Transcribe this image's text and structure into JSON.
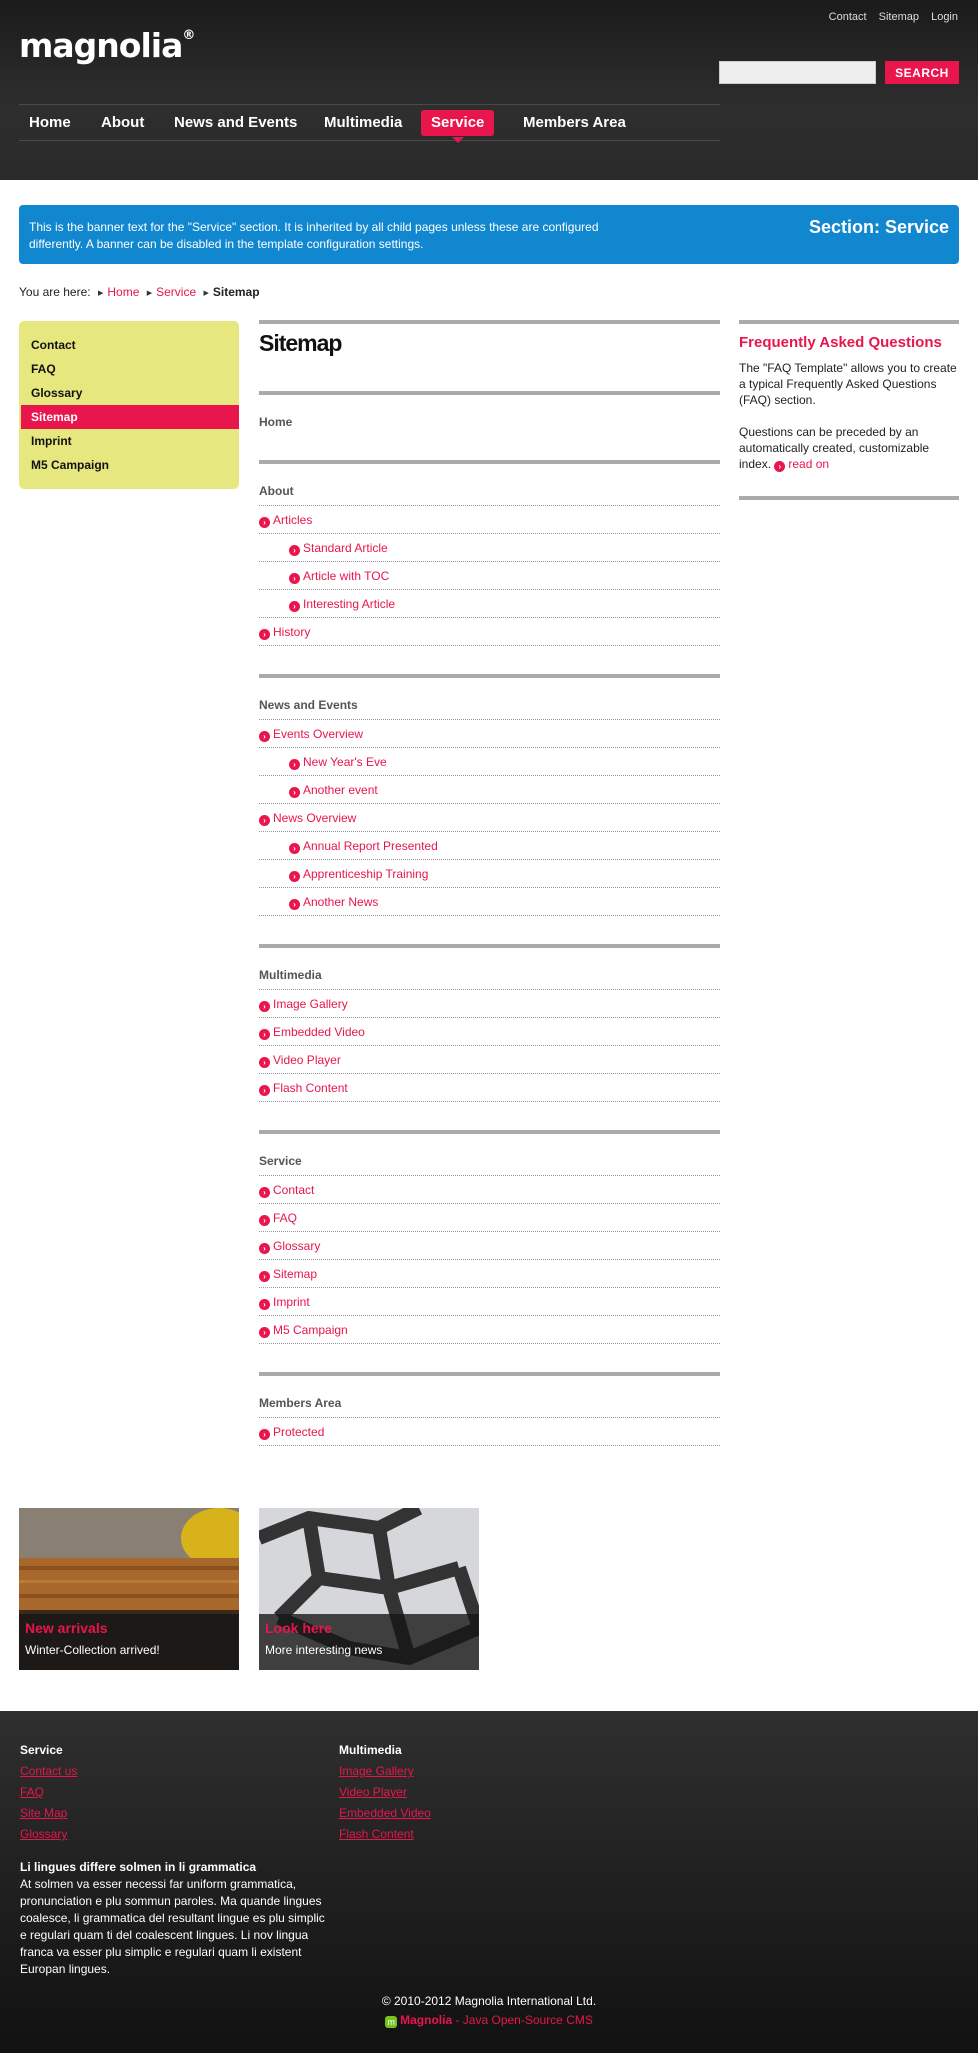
{
  "header": {
    "logo_text": "magnolia",
    "logo_mark": "®",
    "meta_links": [
      "Contact",
      "Sitemap",
      "Login"
    ],
    "search_placeholder": "",
    "search_button": "SEARCH"
  },
  "nav": {
    "items": [
      "Home",
      "About",
      "News and Events",
      "Multimedia",
      "Service",
      "Members Area"
    ],
    "active": "Service"
  },
  "banner": {
    "text": "This is the banner text for the \"Service\" section. It is inherited by all child pages unless these are configured differently. A banner can be disabled in the template configuration settings.",
    "title": "Section: Service"
  },
  "breadcrumb": {
    "prefix": "You are here:",
    "items": [
      "Home",
      "Service"
    ],
    "current": "Sitemap"
  },
  "subnav": {
    "items": [
      "Contact",
      "FAQ",
      "Glossary",
      "Sitemap",
      "Imprint",
      "M5 Campaign"
    ],
    "active": "Sitemap"
  },
  "main": {
    "title": "Sitemap",
    "sections": [
      {
        "heading": "Home",
        "items": []
      },
      {
        "heading": "About",
        "items": [
          {
            "label": "Articles",
            "level": 1
          },
          {
            "label": "Standard Article",
            "level": 2
          },
          {
            "label": "Article with TOC",
            "level": 2
          },
          {
            "label": "Interesting Article",
            "level": 2
          },
          {
            "label": "History",
            "level": 1
          }
        ]
      },
      {
        "heading": "News and Events",
        "items": [
          {
            "label": "Events Overview",
            "level": 1
          },
          {
            "label": "New Year's Eve",
            "level": 2
          },
          {
            "label": "Another event",
            "level": 2
          },
          {
            "label": "News Overview",
            "level": 1
          },
          {
            "label": "Annual Report Presented",
            "level": 2
          },
          {
            "label": "Apprenticeship Training",
            "level": 2
          },
          {
            "label": "Another News",
            "level": 2
          }
        ]
      },
      {
        "heading": "Multimedia",
        "items": [
          {
            "label": "Image Gallery",
            "level": 1
          },
          {
            "label": "Embedded Video",
            "level": 1
          },
          {
            "label": "Video Player",
            "level": 1
          },
          {
            "label": "Flash Content",
            "level": 1
          }
        ]
      },
      {
        "heading": "Service",
        "items": [
          {
            "label": "Contact",
            "level": 1
          },
          {
            "label": "FAQ",
            "level": 1
          },
          {
            "label": "Glossary",
            "level": 1
          },
          {
            "label": "Sitemap",
            "level": 1
          },
          {
            "label": "Imprint",
            "level": 1
          },
          {
            "label": "M5 Campaign",
            "level": 1
          }
        ]
      },
      {
        "heading": "Members Area",
        "items": [
          {
            "label": "Protected",
            "level": 1
          }
        ]
      }
    ]
  },
  "faq": {
    "title": "Frequently Asked Questions",
    "p1": "The \"FAQ Template\" allows you to create a typical Frequently Asked Questions (FAQ) section.",
    "p2": "Questions can be preceded by an automatically created, customizable index.",
    "read_on": "read on"
  },
  "promos": [
    {
      "title": "New arrivals",
      "text": "Winter-Collection arrived!"
    },
    {
      "title": "Look here",
      "text": "More interesting news"
    }
  ],
  "footer": {
    "col1": {
      "title": "Service",
      "links": [
        "Contact us",
        "FAQ",
        "Site Map",
        "Glossary"
      ]
    },
    "col2": {
      "title": "Multimedia",
      "links": [
        "Image Gallery",
        "Video Player",
        "Embedded Video",
        "Flash Content"
      ]
    },
    "text_title": "Li lingues differe solmen in li grammatica",
    "text_body": "At solmen va esser necessi far uniform grammatica, pronunciation e plu sommun paroles. Ma quande lingues coalesce, li grammatica del resultant lingue es plu simplic e regulari quam ti del coalescent lingues. Li nov lingua franca va esser plu simplic e regulari quam li existent Europan lingues.",
    "copyright": "© 2010-2012 Magnolia International Ltd.",
    "cms_brand": "Magnolia",
    "cms_tagline": " - Java Open-Source CMS"
  },
  "colors": {
    "accent": "#e8164c",
    "banner": "#1187cf",
    "subnav": "#e6e77f",
    "header": "#262626"
  },
  "icons": [
    "arrow-right-circle-icon",
    "breadcrumb-arrow-icon",
    "magnolia-logo-icon"
  ]
}
